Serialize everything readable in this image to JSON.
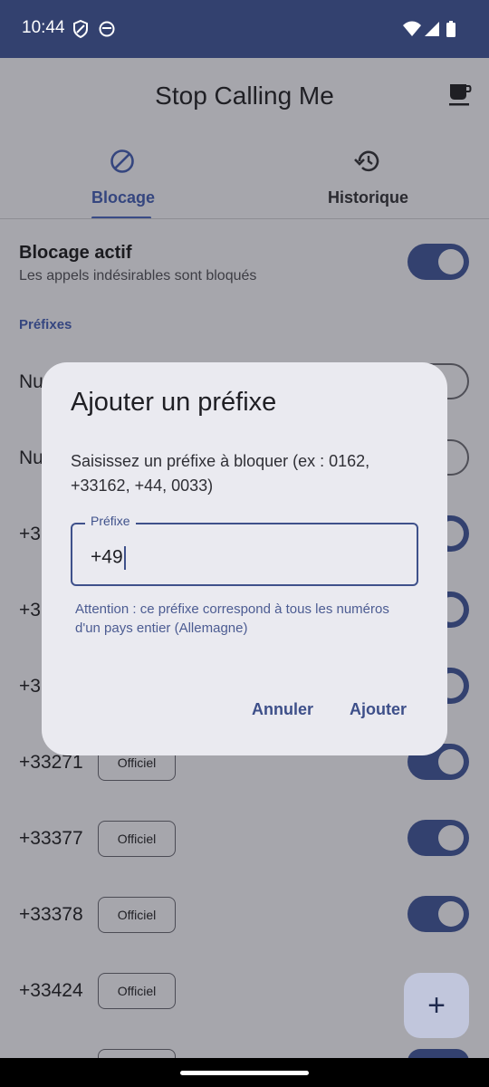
{
  "status": {
    "time": "10:44"
  },
  "app": {
    "title": "Stop Calling Me",
    "tabs": [
      {
        "label": "Blocage"
      },
      {
        "label": "Historique"
      }
    ],
    "blocking": {
      "title": "Blocage actif",
      "subtitle": "Les appels indésirables sont bloqués",
      "enabled": true
    },
    "section_label": "Préfixes",
    "rows": [
      {
        "number": "Nu",
        "badge": "",
        "enabled": false
      },
      {
        "number": "Nu",
        "badge": "",
        "enabled": false
      },
      {
        "number": "+3",
        "badge": "",
        "enabled": true
      },
      {
        "number": "+3",
        "badge": "",
        "enabled": true
      },
      {
        "number": "+3",
        "badge": "",
        "enabled": true
      },
      {
        "number": "+33271",
        "badge": "Officiel",
        "enabled": true
      },
      {
        "number": "+33377",
        "badge": "Officiel",
        "enabled": true
      },
      {
        "number": "+33378",
        "badge": "Officiel",
        "enabled": true
      },
      {
        "number": "+33424",
        "badge": "Officiel",
        "enabled": true
      }
    ],
    "fab_label": "+"
  },
  "dialog": {
    "title": "Ajouter un préfixe",
    "text": "Saisissez un préfixe à bloquer (ex : 0162, +33162, +44, 0033)",
    "field_label": "Préfixe",
    "field_value": "+49",
    "helper": "Attention : ce préfixe correspond à tous les numéros d'un pays entier (Allemagne)",
    "cancel_label": "Annuler",
    "add_label": "Ajouter"
  },
  "colors": {
    "accent": "#33416f",
    "status_bar": "#33416f",
    "scrim_background": "#a6a6ac",
    "dialog_bg": "#eaeaf0"
  }
}
